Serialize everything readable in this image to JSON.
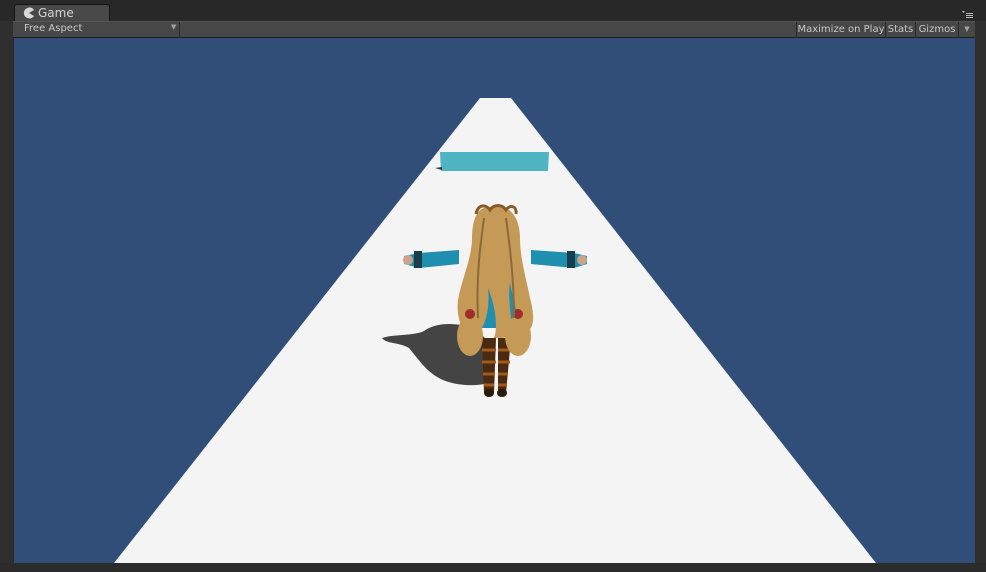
{
  "window": {
    "tab": {
      "label": "Game",
      "icon": "game-pacman-icon"
    },
    "menu_icon": "tab-menu-icon"
  },
  "toolbar": {
    "aspect": {
      "label": "Free Aspect",
      "arrow_icon": "dropdown-arrow-icon"
    },
    "maximize_label": "Maximize on Play",
    "stats_label": "Stats",
    "gizmos_label": "Gizmos",
    "gizmos_arrow_icon": "dropdown-arrow-icon"
  },
  "scene": {
    "sky_color": "#314e79",
    "road_color": "#f4f4f4",
    "obstacle_color": "#4fb5c2",
    "character": "anime-girl-t-pose",
    "shadow": true
  }
}
